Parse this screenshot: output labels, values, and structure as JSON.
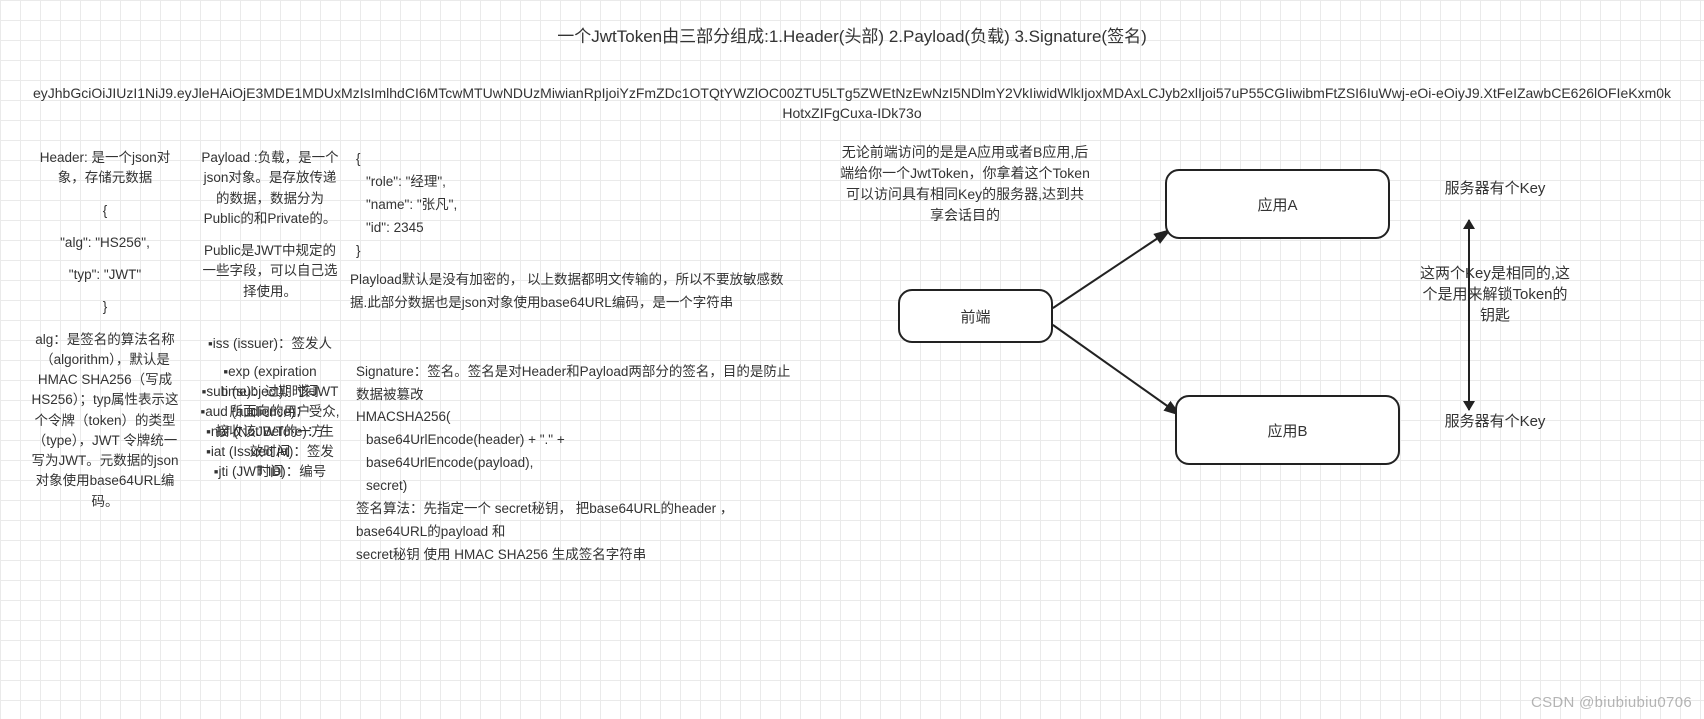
{
  "title": "一个JwtToken由三部分组成:1.Header(头部)  2.Payload(负载)  3.Signature(签名)",
  "token": "eyJhbGciOiJIUzI1NiJ9.eyJleHAiOjE3MDE1MDUxMzIsImlhdCI6MTcwMTUwNDUzMiwianRpIjoiYzFmZDc1OTQtYWZlOC00ZTU5LTg5ZWEtNzEwNzI5NDlmY2VkIiwidWlkIjoxMDAxLCJyb2xlIjoi57uP55CGIiwibmFtZSI6IuWwj-eOi-eOiyJ9.XtFeIZawbCE626lOFIeKxm0kHotxZIFgCuxa-IDk73o",
  "col1": {
    "l1": "Header: 是一个json对象，存储元数据",
    "l2": "{",
    "l3": "\"alg\": \"HS256\",",
    "l4": "\"typ\": \"JWT\"",
    "l5": "}",
    "l6": "alg：是签名的算法名称（algorithm），默认是  HMAC SHA256（写成HS256）；typ属性表示这个令牌（token）的类型（type），JWT 令牌统一写为JWT。元数据的json对象使用base64URL编码。"
  },
  "col2": {
    "l1": "Payload :负载，是一个json对象。是存放传递的数据，数据分为Public的和Private的。",
    "l2": "Public是JWT中规定的一些字段，可以自己选择使用。",
    "b1": "▪iss (issuer)：签发人",
    "b2": "▪exp (expiration time)：过期时间",
    "b3": "▪sub (subject)：该JWT所面向的用户",
    "b4": "▪aud (audience)：受众,接收该JWT的一方",
    "b5": "▪nbf (Not Before)：生效时间",
    "b6": "▪iat (Issued At)：签发时间",
    "b7": "▪jti (JWT ID)：编号"
  },
  "col3": {
    "j1": "{",
    "j2": "\"role\": \"经理\",",
    "j3": "\"name\": \"张凡\",",
    "j4": "\"id\": 2345",
    "j5": "}",
    "p1": "Playload默认是没有加密的，  以上数据都明文传输的，所以不要放敏感数据.此部分数据也是json对象使用base64URL编码，是一个字符串",
    "s1": "Signature：签名。签名是对Header和Payload两部分的签名，目的是防止数据被篡改",
    "s2": "HMACSHA256(",
    "s3": "base64UrlEncode(header) + \".\" +",
    "s4": "base64UrlEncode(payload),",
    "s5": "secret)",
    "s6": "签名算法：先指定一个  secret秘钥，  把base64URL的header ，  base64URL的payload 和",
    "s7": "secret秘钥  使用  HMAC SHA256 生成签名字符串"
  },
  "paratop": "无论前端访问的是是A应用或者B应用,后端给你一个JwtToken，你拿着这个Token可以访问具有相同Key的服务器,达到共享会话目的",
  "boxes": {
    "front": "前端",
    "appA": "应用A",
    "appB": "应用B"
  },
  "rnotes": {
    "n1": "服务器有个Key",
    "n2": "这两个Key是相同的,这个是用来解锁Token的钥匙",
    "n3": "服务器有个Key"
  },
  "watermark": "CSDN @biubiubiu0706"
}
